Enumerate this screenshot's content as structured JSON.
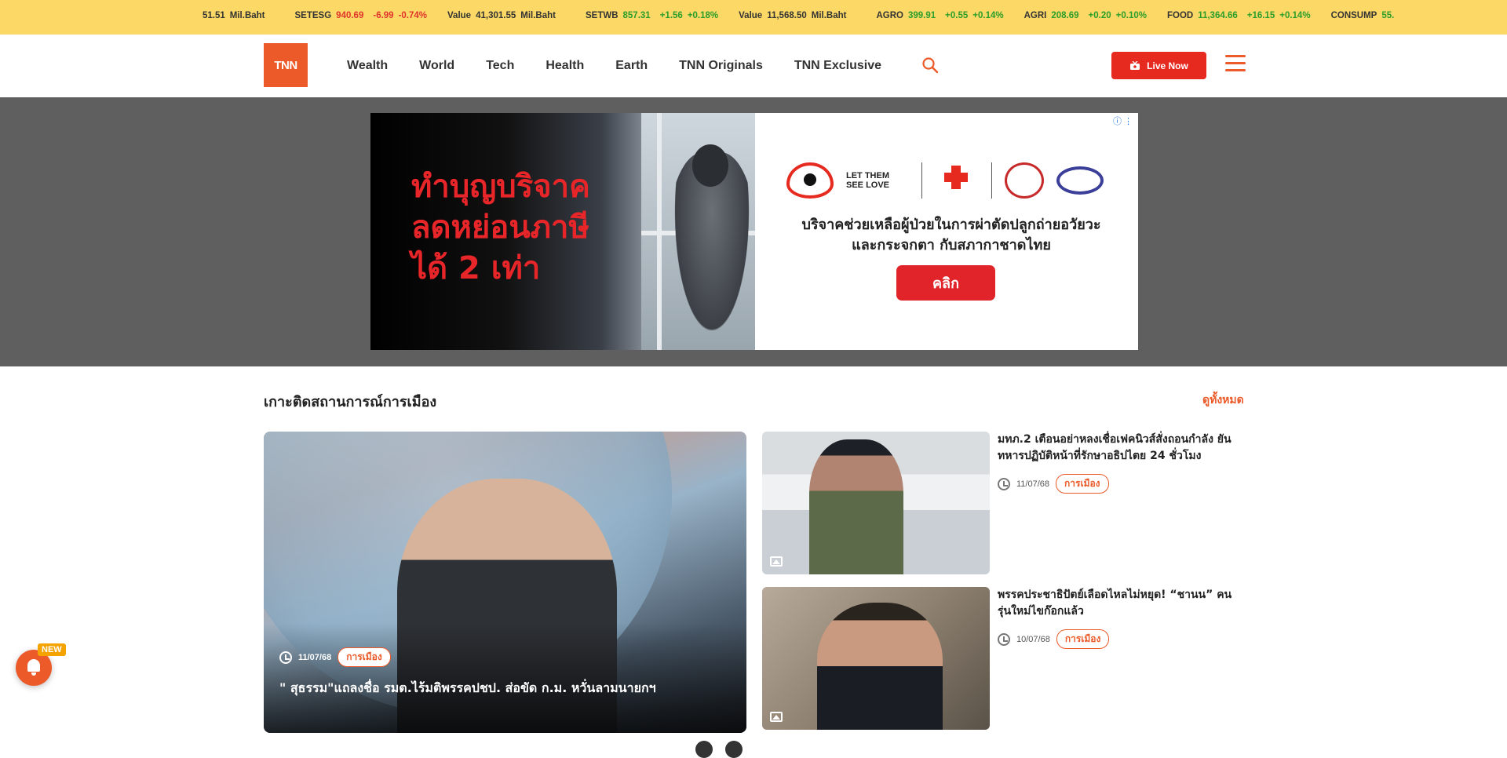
{
  "ticker": [
    {
      "label": "",
      "value": "51.51",
      "unit": "Mil.Baht",
      "change": "",
      "pct": "",
      "dir": "neu"
    },
    {
      "label": "SETESG",
      "value": "940.69",
      "unit": "",
      "change": "-6.99",
      "pct": "-0.74%",
      "dir": "neg"
    },
    {
      "label": "Value",
      "value": "41,301.55",
      "unit": "Mil.Baht",
      "change": "",
      "pct": "",
      "dir": "neu"
    },
    {
      "label": "SETWB",
      "value": "857.31",
      "unit": "",
      "change": "+1.56",
      "pct": "+0.18%",
      "dir": "pos"
    },
    {
      "label": "Value",
      "value": "11,568.50",
      "unit": "Mil.Baht",
      "change": "",
      "pct": "",
      "dir": "neu"
    },
    {
      "label": "AGRO",
      "value": "399.91",
      "unit": "",
      "change": "+0.55",
      "pct": "+0.14%",
      "dir": "pos"
    },
    {
      "label": "AGRI",
      "value": "208.69",
      "unit": "",
      "change": "+0.20",
      "pct": "+0.10%",
      "dir": "pos"
    },
    {
      "label": "FOOD",
      "value": "11,364.66",
      "unit": "",
      "change": "+16.15",
      "pct": "+0.14%",
      "dir": "pos"
    },
    {
      "label": "CONSUMP",
      "value": "55.",
      "unit": "",
      "change": "",
      "pct": "",
      "dir": "pos"
    }
  ],
  "header": {
    "logo": "TNN",
    "nav": [
      "Wealth",
      "World",
      "Tech",
      "Health",
      "Earth",
      "TNN Originals",
      "TNN Exclusive"
    ],
    "live_label": "Live Now"
  },
  "ad": {
    "headline": [
      "ทำบุญบริจาค",
      "ลดหย่อนภาษี",
      "ได้ 2 เท่า"
    ],
    "logo_text": "LET THEM SEE LOVE",
    "desc": [
      "บริจาคช่วยเหลือผู้ป่วยในการผ่าตัดปลูกถ่ายอวัยวะ",
      "และกระจกตา กับสภากาชาดไทย"
    ],
    "cta": "คลิก",
    "info": "ⓘ ⋮"
  },
  "section": {
    "title": "เกาะติดสถานการณ์การเมือง",
    "see_all": "ดูทั้งหมด"
  },
  "main_story": {
    "date": "11/07/68",
    "tag": "การเมือง",
    "title": "\" สุธรรม\"แถลงชื่อ รมต.ไร้มติพรรคปชป. ส่อขัด ก.ม. หวั่นลามนายกฯ"
  },
  "side_stories": [
    {
      "title": "มทภ.2 เตือนอย่าหลงเชื่อเฟคนิวส์สั่งถอนกำลัง ยันทหารปฏิบัติหน้าที่รักษาอธิปไตย 24 ชั่วโมง",
      "date": "11/07/68",
      "tag": "การเมือง"
    },
    {
      "title": "พรรคประชาธิปัตย์เลือดไหลไม่หยุด! “ชานน” คนรุ่นใหม่ไขก๊อกแล้ว",
      "date": "10/07/68",
      "tag": "การเมือง"
    }
  ],
  "float": {
    "badge": "NEW"
  },
  "colors": {
    "accent": "#eb5a28",
    "ticker_bg": "#fcd966",
    "live": "#e62a1f",
    "neg": "#e0332c",
    "pos": "#2a9d2a"
  }
}
